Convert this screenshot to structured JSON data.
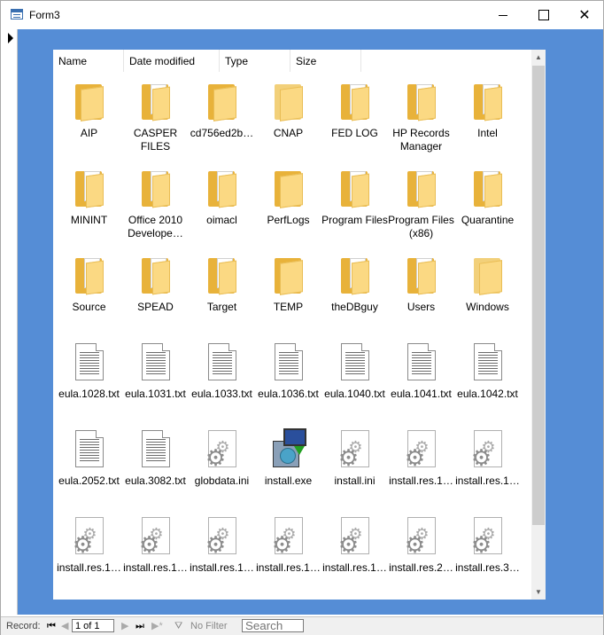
{
  "window": {
    "title": "Form3",
    "icon": "form-icon"
  },
  "listview": {
    "columns": [
      "Name",
      "Date modified",
      "Type",
      "Size"
    ],
    "items": [
      {
        "label": "AIP",
        "icon": "folder"
      },
      {
        "label": "CASPER FILES",
        "icon": "folder-docs"
      },
      {
        "label": "cd756ed2b…",
        "icon": "folder"
      },
      {
        "label": "CNAP",
        "icon": "folder-light"
      },
      {
        "label": "FED LOG",
        "icon": "folder-docs"
      },
      {
        "label": "HP Records Manager",
        "icon": "folder-docs"
      },
      {
        "label": "Intel",
        "icon": "folder-docs"
      },
      {
        "label": "MININT",
        "icon": "folder-docs"
      },
      {
        "label": "Office 2010 Develope…",
        "icon": "folder-docs"
      },
      {
        "label": "oimacl",
        "icon": "folder-docs"
      },
      {
        "label": "PerfLogs",
        "icon": "folder"
      },
      {
        "label": "Program Files",
        "icon": "folder-docs"
      },
      {
        "label": "Program Files (x86)",
        "icon": "folder-docs"
      },
      {
        "label": "Quarantine",
        "icon": "folder-docs"
      },
      {
        "label": "Source",
        "icon": "folder-docs"
      },
      {
        "label": "SPEAD",
        "icon": "folder-docs"
      },
      {
        "label": "Target",
        "icon": "folder-docs"
      },
      {
        "label": "TEMP",
        "icon": "folder"
      },
      {
        "label": "theDBguy",
        "icon": "folder-docs"
      },
      {
        "label": "Users",
        "icon": "folder-docs"
      },
      {
        "label": "Windows",
        "icon": "folder-light"
      },
      {
        "label": "eula.1028.txt",
        "icon": "text-file"
      },
      {
        "label": "eula.1031.txt",
        "icon": "text-file"
      },
      {
        "label": "eula.1033.txt",
        "icon": "text-file"
      },
      {
        "label": "eula.1036.txt",
        "icon": "text-file"
      },
      {
        "label": "eula.1040.txt",
        "icon": "text-file"
      },
      {
        "label": "eula.1041.txt",
        "icon": "text-file"
      },
      {
        "label": "eula.1042.txt",
        "icon": "text-file"
      },
      {
        "label": "eula.2052.txt",
        "icon": "text-file"
      },
      {
        "label": "eula.3082.txt",
        "icon": "text-file"
      },
      {
        "label": "globdata.ini",
        "icon": "settings-file"
      },
      {
        "label": "install.exe",
        "icon": "installer"
      },
      {
        "label": "install.ini",
        "icon": "settings-file"
      },
      {
        "label": "install.res.1…",
        "icon": "settings-file"
      },
      {
        "label": "install.res.1…",
        "icon": "settings-file"
      },
      {
        "label": "install.res.1…",
        "icon": "settings-file"
      },
      {
        "label": "install.res.1…",
        "icon": "settings-file"
      },
      {
        "label": "install.res.1…",
        "icon": "settings-file"
      },
      {
        "label": "install.res.1…",
        "icon": "settings-file"
      },
      {
        "label": "install.res.1…",
        "icon": "settings-file"
      },
      {
        "label": "install.res.2…",
        "icon": "settings-file"
      },
      {
        "label": "install.res.3…",
        "icon": "settings-file"
      }
    ]
  },
  "statusbar": {
    "record_label": "Record:",
    "record_value": "1 of 1",
    "filter_label": "No Filter",
    "search_placeholder": "Search"
  }
}
